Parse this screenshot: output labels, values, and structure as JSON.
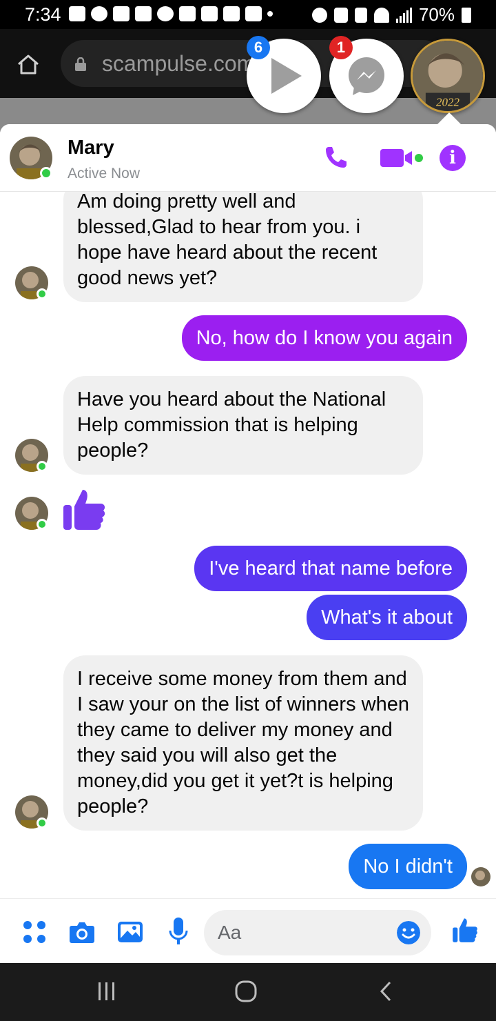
{
  "status_bar": {
    "time": "7:34",
    "battery": "70%"
  },
  "browser": {
    "url": "scampulse.com"
  },
  "chat_heads": {
    "video_badge": "6",
    "messenger_badge": "1",
    "avatar_year": "2022"
  },
  "header": {
    "name": "Mary",
    "status": "Active Now"
  },
  "messages": [
    {
      "side": "in",
      "text": "Am doing pretty well and blessed,Glad to hear from you. i hope have heard about the recent good news yet?"
    },
    {
      "side": "out",
      "text": "No, how do I know you again",
      "color": "#9b1ff0"
    },
    {
      "side": "in",
      "text": "Have you heard about the National Help commission that is helping people?"
    },
    {
      "side": "in",
      "type": "like-sticker"
    },
    {
      "side": "out",
      "text": "I've heard that name before",
      "color": "#5a36f2"
    },
    {
      "side": "out",
      "text": "What's it about",
      "color": "#4a3ff2"
    },
    {
      "side": "in",
      "text": "I receive some money from them and I saw your on the list of winners when they came to deliver my money and they said you will also get the money,did you get it yet?t is helping people?"
    },
    {
      "side": "out",
      "text": "No I didn't",
      "color": "#1877f2"
    }
  ],
  "composer": {
    "placeholder": "Aa"
  },
  "colors": {
    "accent_purple": "#a033ff",
    "messenger_blue": "#1877f2",
    "online_green": "#31cc46"
  },
  "icons": [
    "home-icon",
    "lock-icon",
    "play-icon",
    "messenger-icon",
    "phone-icon",
    "video-camera-icon",
    "info-icon",
    "like-icon",
    "menu-dots-icon",
    "camera-icon",
    "gallery-icon",
    "microphone-icon",
    "emoji-icon",
    "recents-icon",
    "home-circle-icon",
    "back-icon"
  ]
}
